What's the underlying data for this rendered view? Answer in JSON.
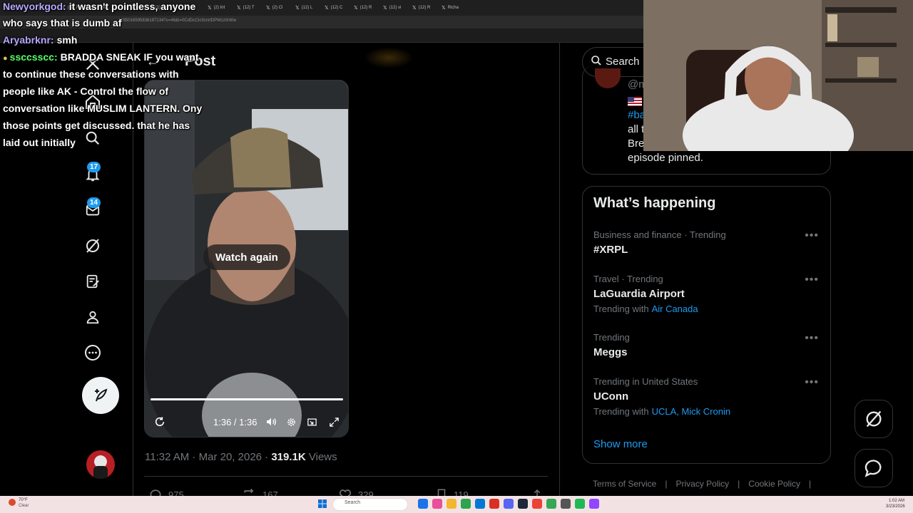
{
  "browser": {
    "tabs": [
      "(115)",
      "(17) Cl",
      "(17) R",
      "(1) Kh",
      "(2) Bi",
      "(1) M",
      "Sarah",
      "(2) Int",
      "(12) T",
      "(2) Cl",
      "(12) L",
      "(12) C",
      "(12) R",
      "(12) vi",
      "(12) R",
      "Richa"
    ],
    "url": "1035016595836187134?s=46&t=0CdDcCIc9znrtDPWzz0rWw"
  },
  "chat": {
    "messages": [
      {
        "user": "Newyorkgod:",
        "user_color": "#b9a7ff",
        "lines": [
          "it wasn't pointless, anyone",
          "who says that is dumb af"
        ]
      },
      {
        "user": "Aryabrknr:",
        "user_color": "#b9a7ff",
        "lines": [
          "smh"
        ]
      },
      {
        "user": "ssccsscc:",
        "user_color": "#57ff6a",
        "lines": [
          "BRADDA SNEAK IF you want",
          "to continue these conversations with",
          "people like AK - Control the flow of",
          "conversation like MUSLIM LANTERN. Ony",
          "those points get discussed. that he has",
          "laid out initially"
        ]
      }
    ]
  },
  "nav": {
    "badges": {
      "notifications": "17",
      "messages": "14"
    },
    "icons": [
      "home-icon",
      "search-icon",
      "bell-icon",
      "mail-icon",
      "grok-icon",
      "premium-icon",
      "profile-icon",
      "more-icon",
      "compose-icon"
    ]
  },
  "post": {
    "header_title": "Post",
    "video": {
      "watch_again": "Watch again",
      "timecode": "1:36 / 1:36",
      "progress": 1.0
    },
    "meta": {
      "time": "11:32 AM",
      "date": "Mar 20, 2026",
      "views_count": "319.1K",
      "views_label": "Views"
    },
    "actions": {
      "replies": "975",
      "reposts": "167",
      "likes": "329",
      "bookmarks": "119"
    }
  },
  "right": {
    "search_placeholder": "Search",
    "profile_card": {
      "handle": "@m",
      "hashtag": "#ba",
      "line2": "all t",
      "line3": "Bre",
      "line4": "episode pinned."
    },
    "trending_title": "What’s happening",
    "trends": [
      {
        "context": "Business and finance · Trending",
        "name": "#XRPL",
        "with_label": "",
        "with_links": ""
      },
      {
        "context": "Travel · Trending",
        "name": "LaGuardia Airport",
        "with_label": "Trending with",
        "with_links": "Air Canada"
      },
      {
        "context": "Trending",
        "name": "Meggs",
        "with_label": "",
        "with_links": ""
      },
      {
        "context": "Trending in United States",
        "name": "UConn",
        "with_label": "Trending with",
        "with_links": "UCLA, Mick Cronin"
      }
    ],
    "show_more": "Show more",
    "footer": [
      "Terms of Service",
      "Privacy Policy",
      "Cookie Policy"
    ]
  },
  "taskbar": {
    "weather_temp": "70°F",
    "weather_cond": "Clear",
    "search": "Search",
    "time": "1:02 AM",
    "date": "3/23/2026"
  },
  "colors": {
    "accent": "#1d9bf0",
    "background": "#000000",
    "muted": "#71767b"
  }
}
